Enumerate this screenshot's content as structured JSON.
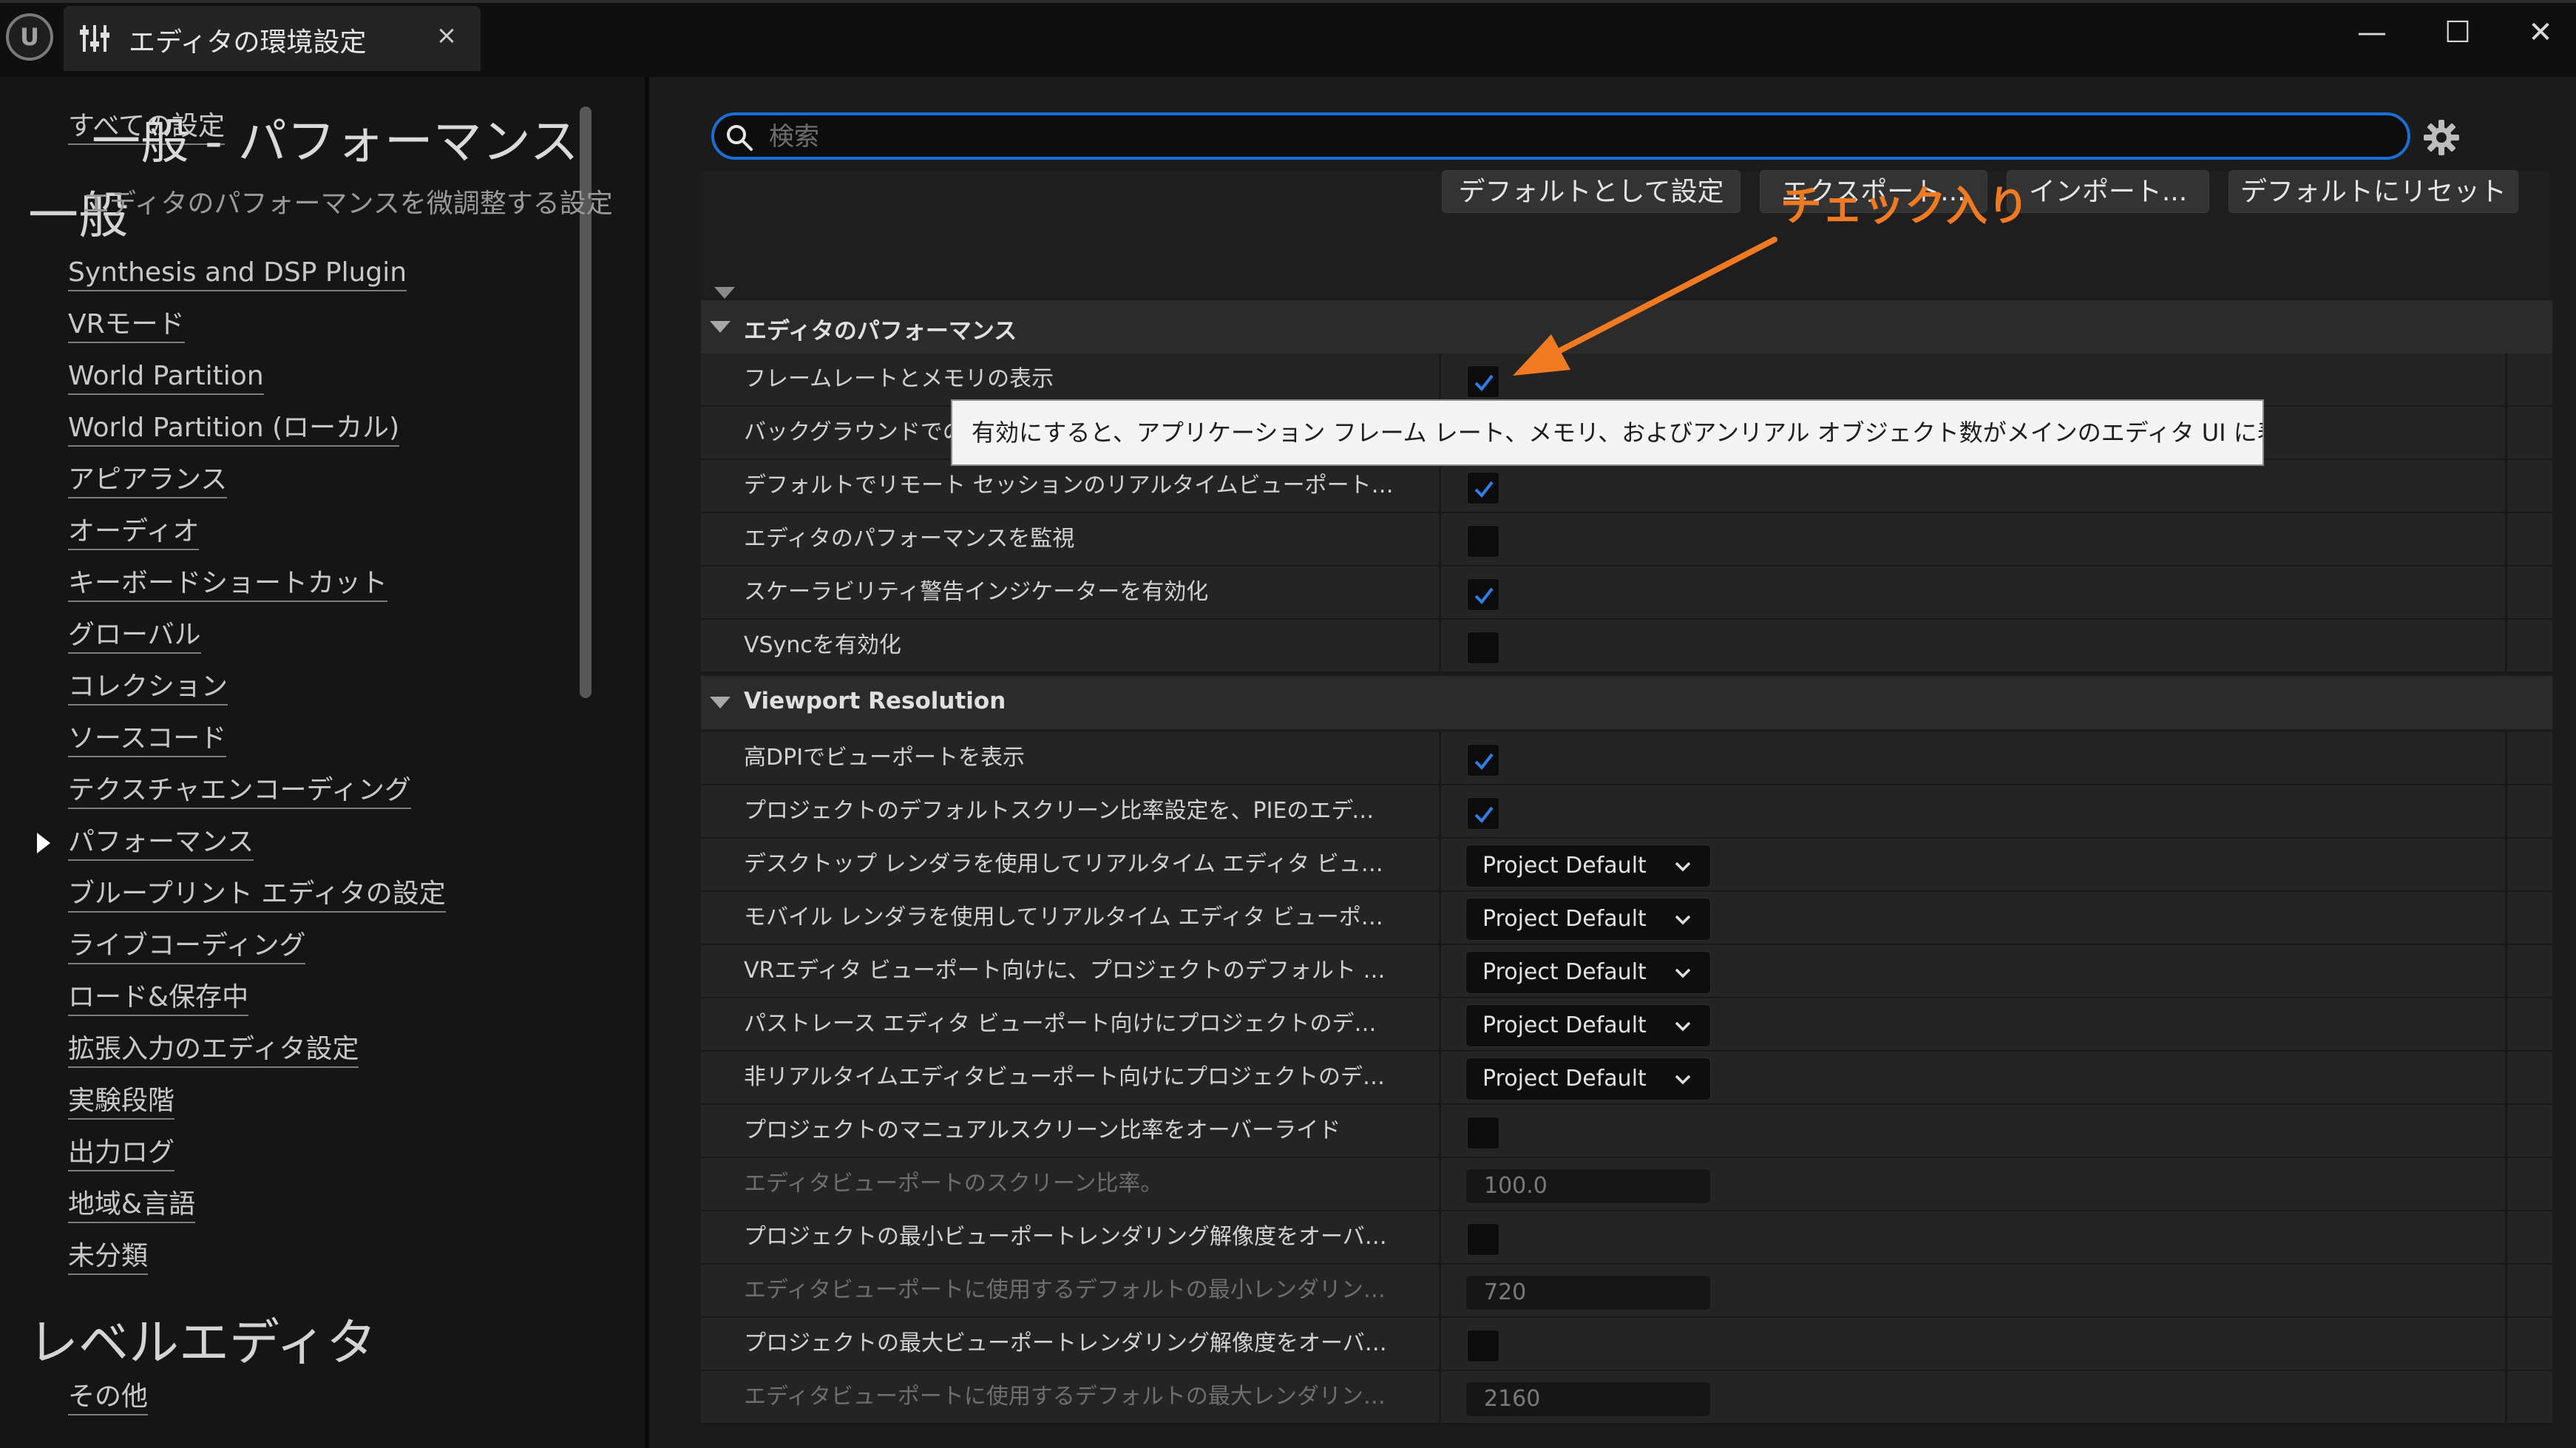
{
  "window": {
    "tab_title": "エディタの環境設定",
    "close_glyph": "×",
    "minimize_glyph": "—",
    "maximize_glyph": "☐",
    "window_close_glyph": "✕",
    "logo_text": "U"
  },
  "sidebar": {
    "all_settings": "すべての設定",
    "section_general": "一般",
    "items": [
      "Synthesis and DSP Plugin",
      "VRモード",
      "World Partition",
      "World Partition (ローカル)",
      "アピアランス",
      "オーディオ",
      "キーボードショートカット",
      "グローバル",
      "コレクション",
      "ソースコード",
      "テクスチャエンコーディング",
      "パフォーマンス",
      "ブループリント エディタの設定",
      "ライブコーディング",
      "ロード&保存中",
      "拡張入力のエディタ設定",
      "実験段階",
      "出力ログ",
      "地域&言語",
      "未分類"
    ],
    "active_item": "パフォーマンス",
    "section_level_editor": "レベルエディタ",
    "level_items": [
      "その他"
    ]
  },
  "search": {
    "placeholder": "検索",
    "value": ""
  },
  "header": {
    "title": "一般 - パフォーマンス",
    "subtitle": "エディタのパフォーマンスを微調整する設定",
    "buttons": {
      "set_default": "デフォルトとして設定",
      "export": "エクスポート...",
      "import": "インポート...",
      "reset": "デフォルトにリセット"
    }
  },
  "annotation": {
    "label": "チェック入り",
    "color": "#f07a22"
  },
  "categories": {
    "editor_performance": "エディタのパフォーマンス",
    "viewport_resolution": "Viewport Resolution"
  },
  "properties": {
    "p1": {
      "label": "フレームレートとメモリの表示",
      "checked": true
    },
    "p2": {
      "label": "バックグラウンドでの処理を抑制",
      "checked": false
    },
    "p3": {
      "label": "デフォルトでリモート セッションのリアルタイムビューポートを無効にする",
      "checked": true
    },
    "p4": {
      "label": "エディタのパフォーマンスを監視",
      "checked": false
    },
    "p5": {
      "label": "スケーラビリティ警告インジケーターを有効化",
      "checked": true
    },
    "p6": {
      "label": "VSyncを有効化",
      "checked": false
    },
    "v1": {
      "label": "高DPIでビューポートを表示",
      "checked": true
    },
    "v2": {
      "label": "プロジェクトのデフォルトスクリーン比率設定を、PIEのエディタビューポー...",
      "checked": true
    },
    "v3": {
      "label": "デスクトップ レンダラを使用してリアルタイム エディタ ビューポート向けに...",
      "value": "Project Default"
    },
    "v4": {
      "label": "モバイル レンダラを使用してリアルタイム エディタ ビューポート向けに、プ...",
      "value": "Project Default"
    },
    "v5": {
      "label": "VRエディタ ビューポート向けに、プロジェクトのデフォルト スクリーン比率...",
      "value": "Project Default"
    },
    "v6": {
      "label": "パストレース エディタ ビューポート向けにプロジェクトのデフォルト スクリ...",
      "value": "Project Default"
    },
    "v7": {
      "label": "非リアルタイムエディタビューポート向けにプロジェクトのデフォルトスクリ...",
      "value": "Project Default"
    },
    "v8": {
      "label": "プロジェクトのマニュアルスクリーン比率をオーバーライド",
      "checked": false
    },
    "v9": {
      "label": "エディタビューポートのスクリーン比率。",
      "value": "100.0"
    },
    "v10": {
      "label": "プロジェクトの最小ビューポートレンダリング解像度をオーバーライド",
      "checked": false
    },
    "v11": {
      "label": "エディタビューポートに使用するデフォルトの最小レンダリング解像度。",
      "value": "720"
    },
    "v12": {
      "label": "プロジェクトの最大ビューポートレンダリング解像度をオーバーライド",
      "checked": false
    },
    "v13": {
      "label": "エディタビューポートに使用するデフォルトの最大レンダリング解像度。",
      "value": "2160"
    }
  },
  "tooltip": {
    "text": "有効にすると、アプリケーション フレーム レート、メモリ、およびアンリアル オブジェクト数がメインのエディタ UI に表示されます"
  },
  "colors": {
    "accent": "#1a6fd6",
    "check": "#2f7fe8",
    "annotation": "#f07a22"
  }
}
